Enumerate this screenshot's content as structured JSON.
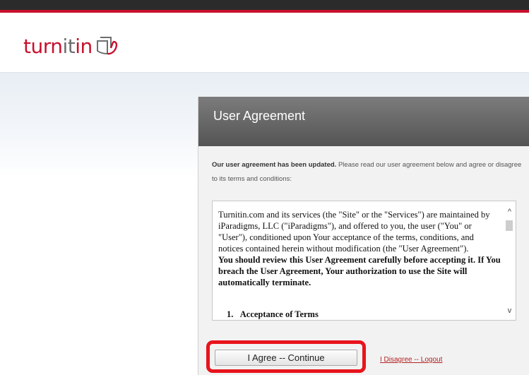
{
  "brand": {
    "logo_red": "turn",
    "logo_gray": "it",
    "logo_red2": "in",
    "accent_color": "#c8102e"
  },
  "card": {
    "title": "User Agreement",
    "intro_bold": "Our user agreement has been updated.",
    "intro_rest": " Please read our user agreement below and agree or disagree to its terms and conditions:"
  },
  "agreement": {
    "paragraph": "Turnitin.com and its services (the \"Site\" or the \"Services\") are maintained by iParadigms, LLC (\"iParadigms\"), and offered to you, the user (\"You\" or \"User\"), conditioned upon Your acceptance of the terms, conditions, and notices contained herein without modification (the \"User Agreement\").",
    "warning": "You should review this User Agreement carefully before accepting it. If You breach the User Agreement, Your authorization to use the Site will automatically terminate.",
    "section_1": "1.   Acceptance of Terms"
  },
  "scrollbar": {
    "up_icon": "chevron-up-icon",
    "down_icon": "chevron-down-icon",
    "up_glyph": "^",
    "down_glyph": "v"
  },
  "actions": {
    "agree_label": "I Agree -- Continue",
    "disagree_label": "I Disagree -- Logout",
    "highlight_color": "#e8141c"
  }
}
